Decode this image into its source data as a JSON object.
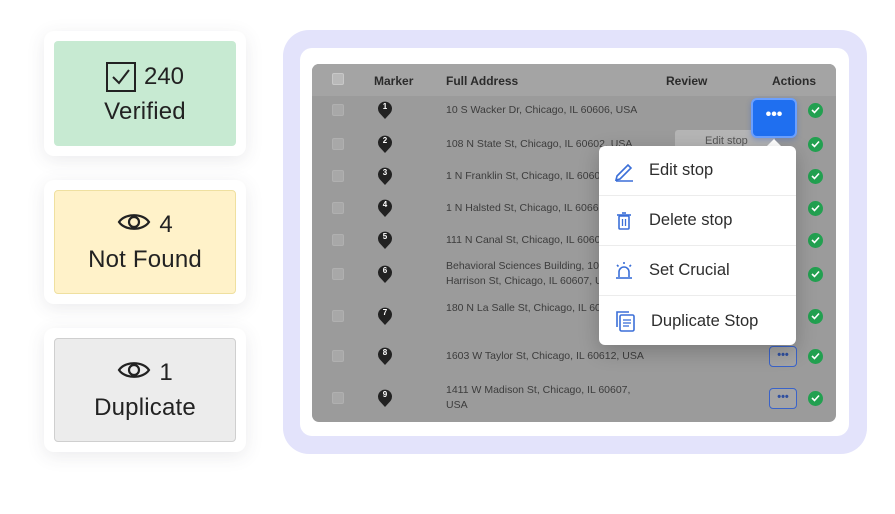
{
  "status_cards": [
    {
      "count": "240",
      "label": "Verified",
      "icon": "checkbox-icon"
    },
    {
      "count": "4",
      "label": "Not Found",
      "icon": "eye-icon"
    },
    {
      "count": "1",
      "label": "Duplicate",
      "icon": "eye-icon"
    }
  ],
  "table": {
    "headers": {
      "marker": "Marker",
      "address": "Full Address",
      "review": "Review",
      "actions": "Actions"
    },
    "rows": [
      {
        "marker": "1",
        "address": "10 S Wacker Dr, Chicago, IL 60606, USA"
      },
      {
        "marker": "2",
        "address": "108 N State St, Chicago, IL 60602, USA"
      },
      {
        "marker": "3",
        "address": "1 N Franklin St, Chicago, IL 60606"
      },
      {
        "marker": "4",
        "address": "1 N Halsted St, Chicago, IL 60661"
      },
      {
        "marker": "5",
        "address": "111 N Canal St, Chicago, IL 60606"
      },
      {
        "marker": "6",
        "address": "Behavioral Sciences Building, 1007 W Harrison St, Chicago, IL 60607, USA"
      },
      {
        "marker": "7",
        "address": "180 N La Salle St, Chicago, IL 60601, USA"
      },
      {
        "marker": "8",
        "address": "1603 W Taylor St, Chicago, IL 60612, USA"
      },
      {
        "marker": "9",
        "address": "1411 W Madison St, Chicago, IL 60607, USA"
      }
    ],
    "action_glyph": "•••",
    "ghost_item": "Edit stop"
  },
  "menu": {
    "items": [
      {
        "label": "Edit stop",
        "icon": "pencil-icon"
      },
      {
        "label": "Delete stop",
        "icon": "trash-icon"
      },
      {
        "label": "Set Crucial",
        "icon": "alarm-icon"
      },
      {
        "label": "Duplicate Stop",
        "icon": "copy-icon"
      }
    ]
  },
  "colors": {
    "accent": "#1f6ff0",
    "verified_bg": "#c7ead2",
    "not_found_bg": "#fff2c9",
    "duplicate_bg": "#ececec",
    "success": "#22a050",
    "frame": "#e3e3fb"
  }
}
